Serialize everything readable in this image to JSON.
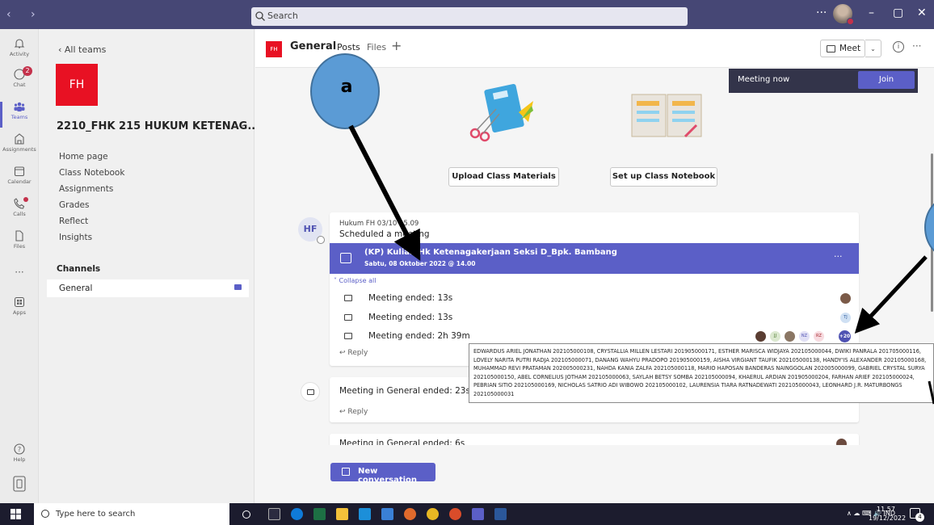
{
  "titlebar": {
    "search_placeholder": "Search",
    "more": "···",
    "nav": "‹ ›",
    "min": "–",
    "max": "▢",
    "close": "✕"
  },
  "rail": {
    "activity": "Activity",
    "chat": "Chat",
    "chat_badge": "2",
    "teams": "Teams",
    "assignments": "Assignments",
    "calendar": "Calendar",
    "calls": "Calls",
    "files": "Files",
    "more": "···",
    "apps": "Apps",
    "help": "Help"
  },
  "left": {
    "all_teams": "‹  All teams",
    "team_initials": "FH",
    "team_name": "2210_FHK 215 HUKUM KETENAG...",
    "team_more": "···",
    "nav": [
      "Home page",
      "Class Notebook",
      "Assignments",
      "Grades",
      "Reflect",
      "Insights"
    ],
    "channels_header": "Channels",
    "channel_general": "General"
  },
  "header": {
    "tile": "FH",
    "title": "General",
    "tab_posts": "Posts",
    "tab_files": "Files",
    "tab_add": "+",
    "meet": "Meet",
    "meet_chev": "⌄",
    "info": "i",
    "more": "···"
  },
  "feed": {
    "meeting_now": "Meeting now",
    "join": "Join",
    "upload_materials": "Upload Class Materials",
    "setup_notebook": "Set up Class Notebook",
    "post_avatar": "HF",
    "post_author": "Hukum FH  03/10 15.09",
    "post_text": "Scheduled a meeting",
    "meeting_title": "(KP) Kuliah Hk Ketenagakerjaan Seksi D_Bpk. Bambang",
    "meeting_date": "Sabtu, 08 Oktober 2022 @ 14.00",
    "banner_more": "···",
    "collapse_all": "˅ Collapse all",
    "rows": [
      "Meeting ended: 13s",
      "Meeting ended: 13s",
      "Meeting ended: 2h 39m"
    ],
    "participants": [
      "JJ",
      "NZ",
      "RZ"
    ],
    "plus_count": "+20",
    "t2": "TJ",
    "reply": "↩ Reply",
    "meeting2": "Meeting in General ended: 23s",
    "reply2": "↩ Reply",
    "meeting3": "Meeting in General ended: 6s",
    "tooltip": "EDWARDUS ARIEL JONATHAN 202105000108, CRYSTALLIA MILLEN LESTARI 201905000171, ESTHER MARISCA WIDJAYA 202105000044, DWIKI PANRALA 201705000116, LOVELY NARITA PUTRI RADJA 202105000071, DANANG WAHYU PRADOPO 201905000159, AISHA VIRGIANT TAUFIK 202105000138, HANDY'IS ALEXANDER 202105000168, MUHAMMAD REVI PRATAMAN 202005000231, NAHDA KANIA ZALFA 202105000118, MARIO HAPOSAN BANDERAS NAINGGOLAN 202005000099, GABRIEL CRYSTAL SURYA 202105000150, ABEL CORNELIUS JOTHAM 202105000063, SAYLAH BETSY SOMBA 202105000094, KHAERUL ARDIAN 201905000204, FARHAN ARIEF 202105000024, PEBRIAN SITIO 202105000169, NICHOLAS SATRIO ADI WIBOWO 202105000102, LAURENSIA TIARA RATNADEWATI 202105000043, LEONHARD J.R. MATURBONGS 202105000031",
    "new_conversation": "New conversation"
  },
  "annotation": {
    "label_a": "a"
  },
  "taskbar": {
    "search_placeholder": "Type here to search",
    "tray": "∧  ☁  ⌨  🔊  IND",
    "time": "11.57",
    "date": "19/12/2022",
    "notifications": "4"
  },
  "colors": {
    "accent": "#5b5fc7",
    "titlebar": "#464775",
    "team_tile": "#e81123",
    "callout": "#5b9bd5"
  }
}
